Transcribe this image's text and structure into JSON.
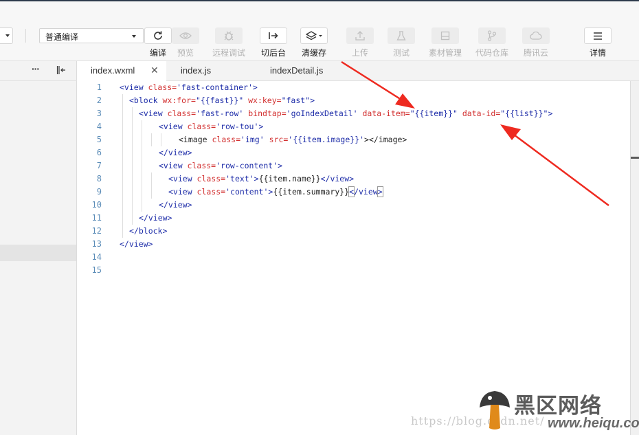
{
  "toolbar": {
    "compile_mode": "普通编译",
    "buttons": [
      {
        "id": "compile",
        "label": "编译",
        "state": "active",
        "icon": "refresh-icon"
      },
      {
        "id": "preview",
        "label": "预览",
        "state": "disabled",
        "icon": "eye-icon"
      },
      {
        "id": "remote_debug",
        "label": "远程调试",
        "state": "disabled",
        "icon": "bug-icon"
      },
      {
        "id": "background",
        "label": "切后台",
        "state": "active",
        "icon": "switch-background-icon"
      },
      {
        "id": "clear_cache",
        "label": "清缓存",
        "state": "active",
        "icon": "layers-icon"
      },
      {
        "id": "upload",
        "label": "上传",
        "state": "disabled",
        "icon": "upload-icon"
      },
      {
        "id": "test",
        "label": "测试",
        "state": "disabled",
        "icon": "flask-icon"
      },
      {
        "id": "assets",
        "label": "素材管理",
        "state": "disabled",
        "icon": "image-icon"
      },
      {
        "id": "repo",
        "label": "代码仓库",
        "state": "disabled",
        "icon": "branch-icon"
      },
      {
        "id": "cloud",
        "label": "腾讯云",
        "state": "disabled",
        "icon": "cloud-icon"
      },
      {
        "id": "details",
        "label": "详情",
        "state": "active",
        "icon": "menu-icon"
      }
    ]
  },
  "tabs": [
    {
      "name": "index.wxml",
      "active": true
    },
    {
      "name": "index.js",
      "active": false
    },
    {
      "name": "indexDetail.js",
      "active": false
    }
  ],
  "editor": {
    "line_numbers": [
      "1",
      "2",
      "3",
      "4",
      "5",
      "6",
      "7",
      "8",
      "9",
      "10",
      "11",
      "12",
      "13",
      "14",
      "15"
    ],
    "line1": {
      "open": "<view ",
      "a1": "class=",
      "v1": "'fast-container'",
      "close": ">"
    },
    "line2": {
      "open": "<block ",
      "a1": "wx:for=",
      "v1": "\"{{fast}}\"",
      "a2": " wx:key=",
      "v2": "\"fast\"",
      "close": ">"
    },
    "line3": {
      "open": "<view ",
      "a1": "class=",
      "v1": "'fast-row'",
      "a2": " bindtap=",
      "v2": "'goIndexDetail'",
      "a3": " data-item=",
      "v3": "\"{{item}}\"",
      "a4": " data-id=",
      "v4": "\"{{list}}\"",
      "close": ">"
    },
    "line4": {
      "open": "<view ",
      "a1": "class=",
      "v1": "'row-tou'",
      "close": ">"
    },
    "line5": {
      "open": "<image ",
      "a1": "class=",
      "v1": "'img'",
      "a2": " src=",
      "v2": "'{{item.image}}'",
      "close": "></image>"
    },
    "line6": {
      "text": "</view>"
    },
    "line7": {
      "open": "<view ",
      "a1": "class=",
      "v1": "'row-content'",
      "close": ">"
    },
    "line8": {
      "open": "<view ",
      "a1": "class=",
      "v1": "'text'",
      "close": ">",
      "content": "{{item.name}}",
      "end": "</view>"
    },
    "line9": {
      "open": "<view ",
      "a1": "class=",
      "v1": "'content'",
      "close": ">",
      "content": "{{item.summary}}",
      "hl1": "<",
      "end_rest": "/view",
      "hl2": ">"
    },
    "line10": {
      "text": "</view>"
    },
    "line11": {
      "text": "</view>"
    },
    "line12": {
      "text": "</block>"
    },
    "line13": {
      "text": "</view>"
    }
  },
  "watermark": {
    "url": "https://blog.csdn.net/",
    "site_cn": "黑区网络",
    "site_domain": "www.heiqu.com"
  },
  "colors": {
    "tag": "#1d2ca8",
    "attr": "#d22f2f",
    "arrow": "#ee2a20",
    "line_number": "#5c8db8"
  }
}
